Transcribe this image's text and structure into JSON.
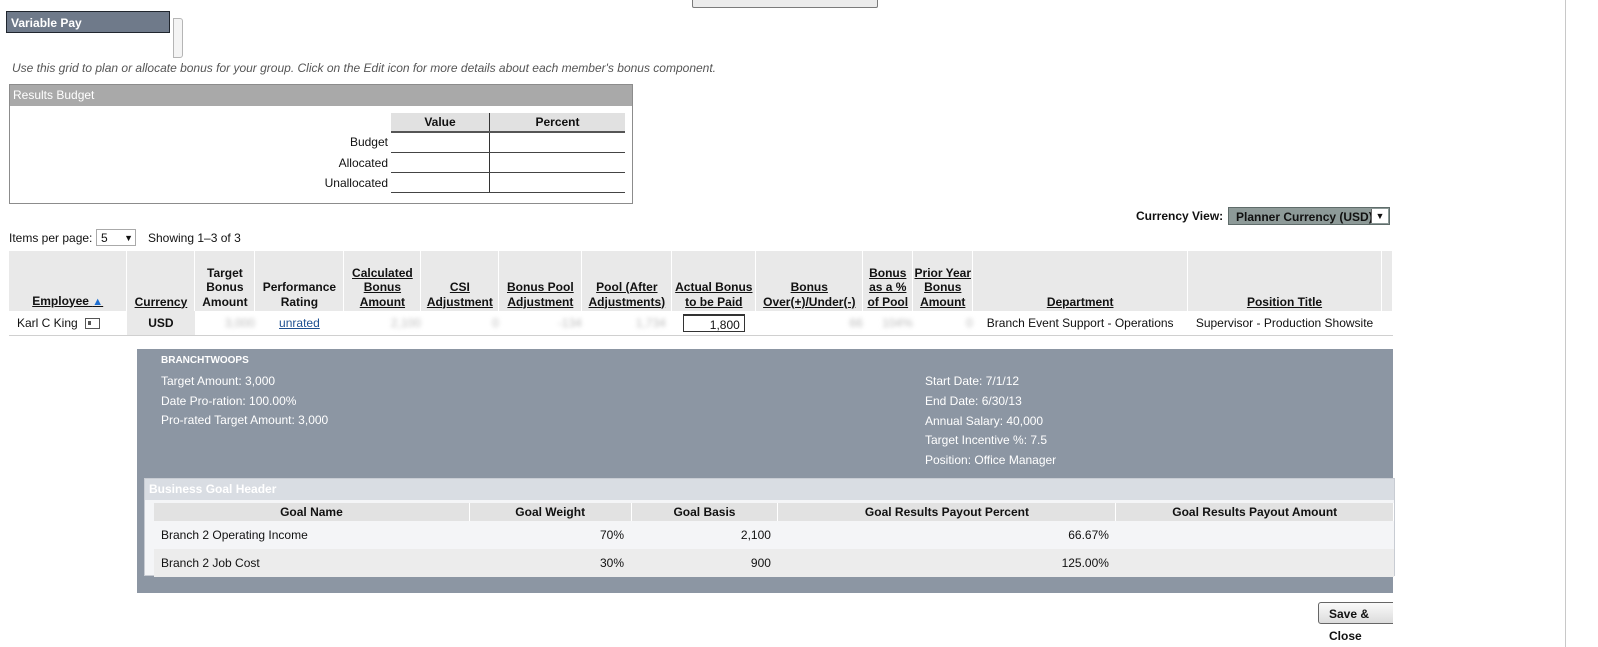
{
  "header": {
    "title": "Variable Pay",
    "intro": "Use this grid to plan or allocate bonus for your group. Click on the Edit icon for more details about each member's bonus component."
  },
  "budget": {
    "title": "Results Budget",
    "col_value": "Value",
    "col_percent": "Percent",
    "rows": [
      {
        "label": "Budget"
      },
      {
        "label": "Allocated"
      },
      {
        "label": "Unallocated"
      }
    ]
  },
  "currency_view": {
    "label": "Currency View:",
    "selected": "Planner Currency (USD)"
  },
  "paging": {
    "items_label": "Items per page:",
    "items_value": "5",
    "showing": "Showing 1–3 of 3"
  },
  "grid": {
    "columns": [
      "Employee",
      "Currency",
      "Target Bonus Amount",
      "Performance Rating",
      "Calculated Bonus Amount",
      "CSI Adjustment",
      "Bonus Pool Adjustment",
      "Pool (After Adjustments)",
      "Actual Bonus to be Paid",
      "Bonus Over(+)/Under(-)",
      "Bonus as a % of Pool",
      "Prior Year Bonus Amount",
      "Department",
      "Position Title"
    ],
    "row": {
      "employee": "Karl C King",
      "currency": "USD",
      "target_bonus": "3,000",
      "rating": "unrated",
      "calculated_bonus": "2,100",
      "csi_adjustment": "0",
      "pool_adjustment": "-134",
      "pool_after": "1,734",
      "actual_bonus": "1,800",
      "over_under": "66",
      "pct_of_pool": "104%",
      "prior_year": "0",
      "department": "Branch Event Support - Operations",
      "position": "Supervisor - Production Showsite"
    }
  },
  "detail": {
    "plan_name": "BRANCHTWOOPS",
    "target_amount": "Target Amount: 3,000",
    "date_proration": "Date Pro-ration: 100.00%",
    "prorated_target": "Pro-rated Target Amount: 3,000",
    "start_date": "Start Date: 7/1/12",
    "end_date": "End Date: 6/30/13",
    "annual_salary": "Annual Salary: 40,000",
    "target_incentive": "Target Incentive %: 7.5",
    "position": "Position: Office Manager"
  },
  "goals": {
    "header": "Business Goal Header",
    "columns": [
      "Goal Name",
      "Goal Weight",
      "Goal Basis",
      "Goal Results Payout Percent",
      "Goal Results Payout Amount"
    ],
    "rows": [
      {
        "name": "Branch 2 Operating Income",
        "weight": "70%",
        "basis": "2,100",
        "percent": "66.67%",
        "amount": ""
      },
      {
        "name": "Branch 2 Job Cost",
        "weight": "30%",
        "basis": "900",
        "percent": "125.00%",
        "amount": ""
      }
    ]
  },
  "footer": {
    "save_label": "Save & Close"
  },
  "icons": {
    "sort": "sort-ascending-icon",
    "employee_card": "employee-card-icon",
    "dropdown": "dropdown-arrow-icon"
  }
}
